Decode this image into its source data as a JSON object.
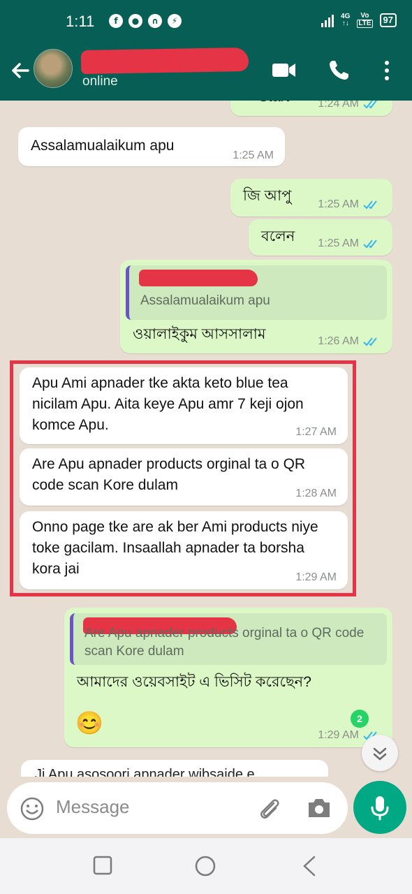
{
  "status_bar": {
    "time": "1:11",
    "notification_icons": [
      "facebook-icon",
      "messenger-icon",
      "headphones-icon",
      "messenger-icon"
    ],
    "network_label_top": "4G",
    "network_label_bottom": "↑↓",
    "volte_top": "Vo",
    "volte_bottom": "LTE",
    "battery": "97"
  },
  "header": {
    "contact_status": "online",
    "icons": [
      "back-arrow-icon",
      "video-call-icon",
      "phone-icon",
      "more-options-icon"
    ]
  },
  "messages": [
    {
      "direction": "outgoing",
      "text": "Start",
      "time": "1:24 AM",
      "ticks": "read"
    },
    {
      "direction": "incoming",
      "text": "Assalamualaikum apu",
      "time": "1:25 AM"
    },
    {
      "direction": "outgoing",
      "text": "জি আপু",
      "time": "1:25 AM",
      "ticks": "read"
    },
    {
      "direction": "outgoing",
      "text": "বলেন",
      "time": "1:25 AM",
      "ticks": "read"
    },
    {
      "direction": "outgoing",
      "quoted_text": "Assalamualaikum apu",
      "text": "ওয়ালাইকুম আসসালাম",
      "time": "1:26 AM",
      "ticks": "read"
    },
    {
      "direction": "incoming",
      "text": "Apu Ami apnader tke akta keto blue tea nicilam Apu. Aita keye Apu amr 7 keji ojon komce Apu.",
      "time": "1:27 AM"
    },
    {
      "direction": "incoming",
      "text": "Are Apu apnader products orginal ta o QR code scan Kore dulam",
      "time": "1:28 AM"
    },
    {
      "direction": "incoming",
      "text": "Onno page tke are ak ber Ami products niye toke gacilam. Insaallah apnader ta borsha kora jai",
      "time": "1:29 AM"
    },
    {
      "direction": "outgoing",
      "quoted_text": "Are Apu apnader products orginal ta o QR code scan Kore dulam",
      "text": "আমাদের ওয়েবসাইট এ ভিসিট করেছেন?",
      "emoji": "😊",
      "time": "1:29 AM",
      "ticks": "read"
    },
    {
      "direction": "incoming",
      "text": "Ji Apu asosoori apnader wibsaide e"
    }
  ],
  "unread_count": "2",
  "composer": {
    "placeholder": "Message",
    "icons": [
      "emoji-icon",
      "attach-icon",
      "camera-icon",
      "microphone-icon"
    ]
  },
  "navigation_bar": {
    "icons": [
      "recents-square-icon",
      "home-circle-icon",
      "back-triangle-icon"
    ]
  },
  "colors": {
    "header": "#075e54",
    "chat_background": "#e7ddd3",
    "incoming_bubble": "#ffffff",
    "outgoing_bubble": "#dcf8c6",
    "read_ticks": "#34b7f1",
    "redaction": "#e53445",
    "mic_button": "#00a884",
    "unread_badge": "#25d366"
  }
}
